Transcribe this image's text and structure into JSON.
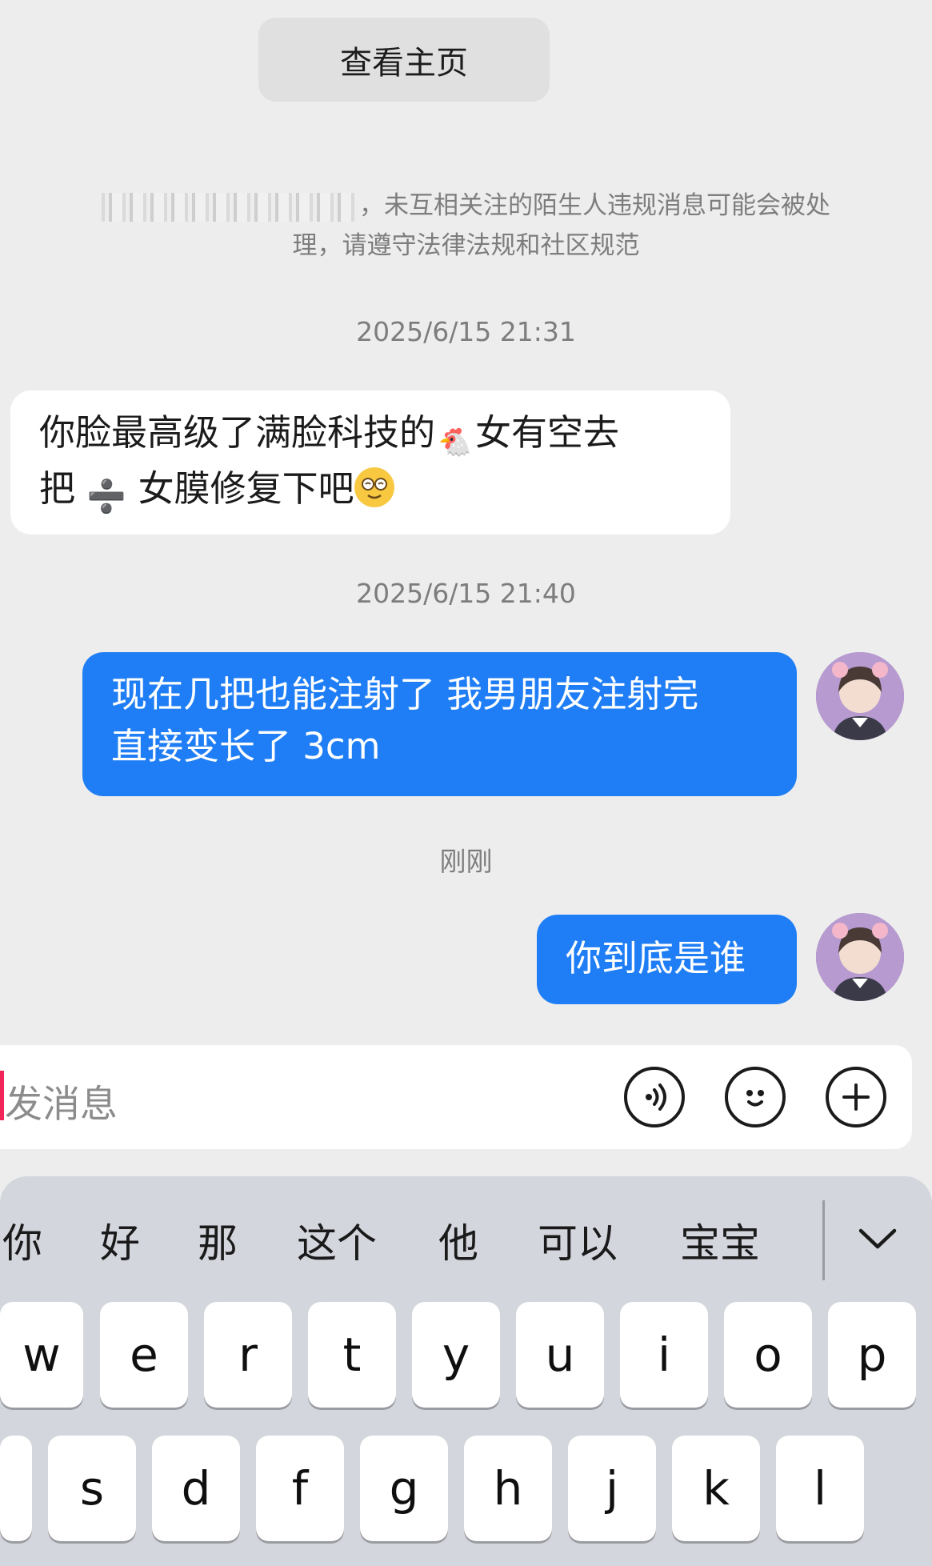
{
  "header": {
    "view_profile_label": "查看主页"
  },
  "notice": {
    "line1_text": "，未互相关注的陌生人违规消息可能会被处",
    "line2_text": "理，请遵守法律法规和社区规范"
  },
  "messages": [
    {
      "type": "timestamp",
      "text": "2025/6/15 21:31"
    },
    {
      "type": "incoming",
      "line1": "你脸最高级了满脸科技的",
      "line1_after": "女有空去",
      "line2_before": "把",
      "line2_mid": "女膜修复下吧",
      "emoji_chicken": "🐔",
      "emoji_divide": "➗",
      "emoji_face": "😵"
    },
    {
      "type": "timestamp",
      "text": "2025/6/15 21:40"
    },
    {
      "type": "outgoing",
      "line1": "现在几把也能注射了 我男朋友注射完",
      "line2": "直接变长了 3cm"
    },
    {
      "type": "timestamp",
      "text": "刚刚"
    },
    {
      "type": "outgoing",
      "text": "你到底是谁"
    }
  ],
  "input": {
    "placeholder": "发消息"
  },
  "icons": [
    "voice-icon",
    "emoji-icon",
    "plus-icon",
    "chevron-down-icon"
  ],
  "keyboard": {
    "candidates": [
      "你",
      "好",
      "那",
      "这个",
      "他",
      "可以",
      "宝宝"
    ],
    "row1": [
      "w",
      "e",
      "r",
      "t",
      "y",
      "u",
      "i",
      "o",
      "p"
    ],
    "row2": [
      "s",
      "d",
      "f",
      "g",
      "h",
      "j",
      "k",
      "l"
    ]
  },
  "colors": {
    "outgoing_bubble": "#1f7ef5",
    "cursor": "#f0265a",
    "background": "#ededed"
  }
}
